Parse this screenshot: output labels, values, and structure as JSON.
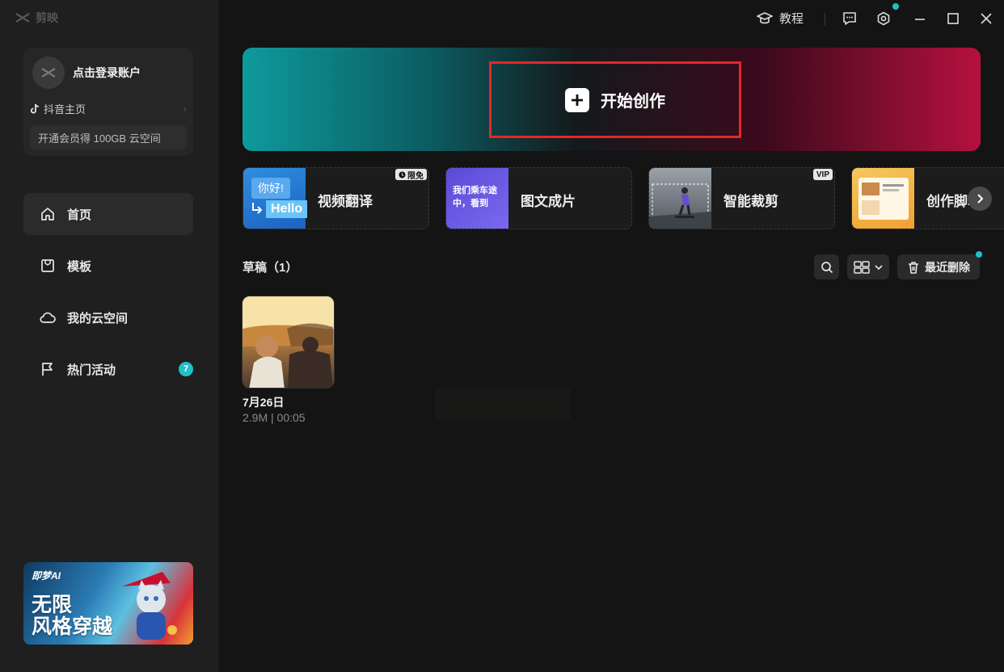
{
  "app": {
    "name": "剪映"
  },
  "account": {
    "login": "点击登录账户",
    "douyin": "抖音主页",
    "vip_promo": "开通会员得 100GB 云空间"
  },
  "nav": [
    {
      "label": "首页",
      "icon": "home-icon",
      "active": true
    },
    {
      "label": "模板",
      "icon": "template-icon"
    },
    {
      "label": "我的云空间",
      "icon": "cloud-icon"
    },
    {
      "label": "热门活动",
      "icon": "flag-icon",
      "badge": "7"
    }
  ],
  "ad": {
    "brand": "即梦AI",
    "title_line1": "无限",
    "title_line2": "风格穿越"
  },
  "titlebar": {
    "tutorial": "教程"
  },
  "hero": {
    "start_label": "开始创作"
  },
  "features": [
    {
      "label": "视频翻译",
      "tag": "限免",
      "thumb_text_1": "你好!",
      "thumb_text_2": "Hello"
    },
    {
      "label": "图文成片",
      "thumb_text": "我们乘车途中，看到"
    },
    {
      "label": "智能裁剪",
      "tag": "VIP"
    },
    {
      "label": "创作脚本"
    }
  ],
  "drafts": {
    "title": "草稿（1）",
    "recent_delete": "最近删除",
    "items": [
      {
        "date": "7月26日",
        "meta": "2.9M | 00:05"
      }
    ]
  },
  "colors": {
    "accent": "#21c0c8",
    "highlight_border": "#e4272a"
  }
}
